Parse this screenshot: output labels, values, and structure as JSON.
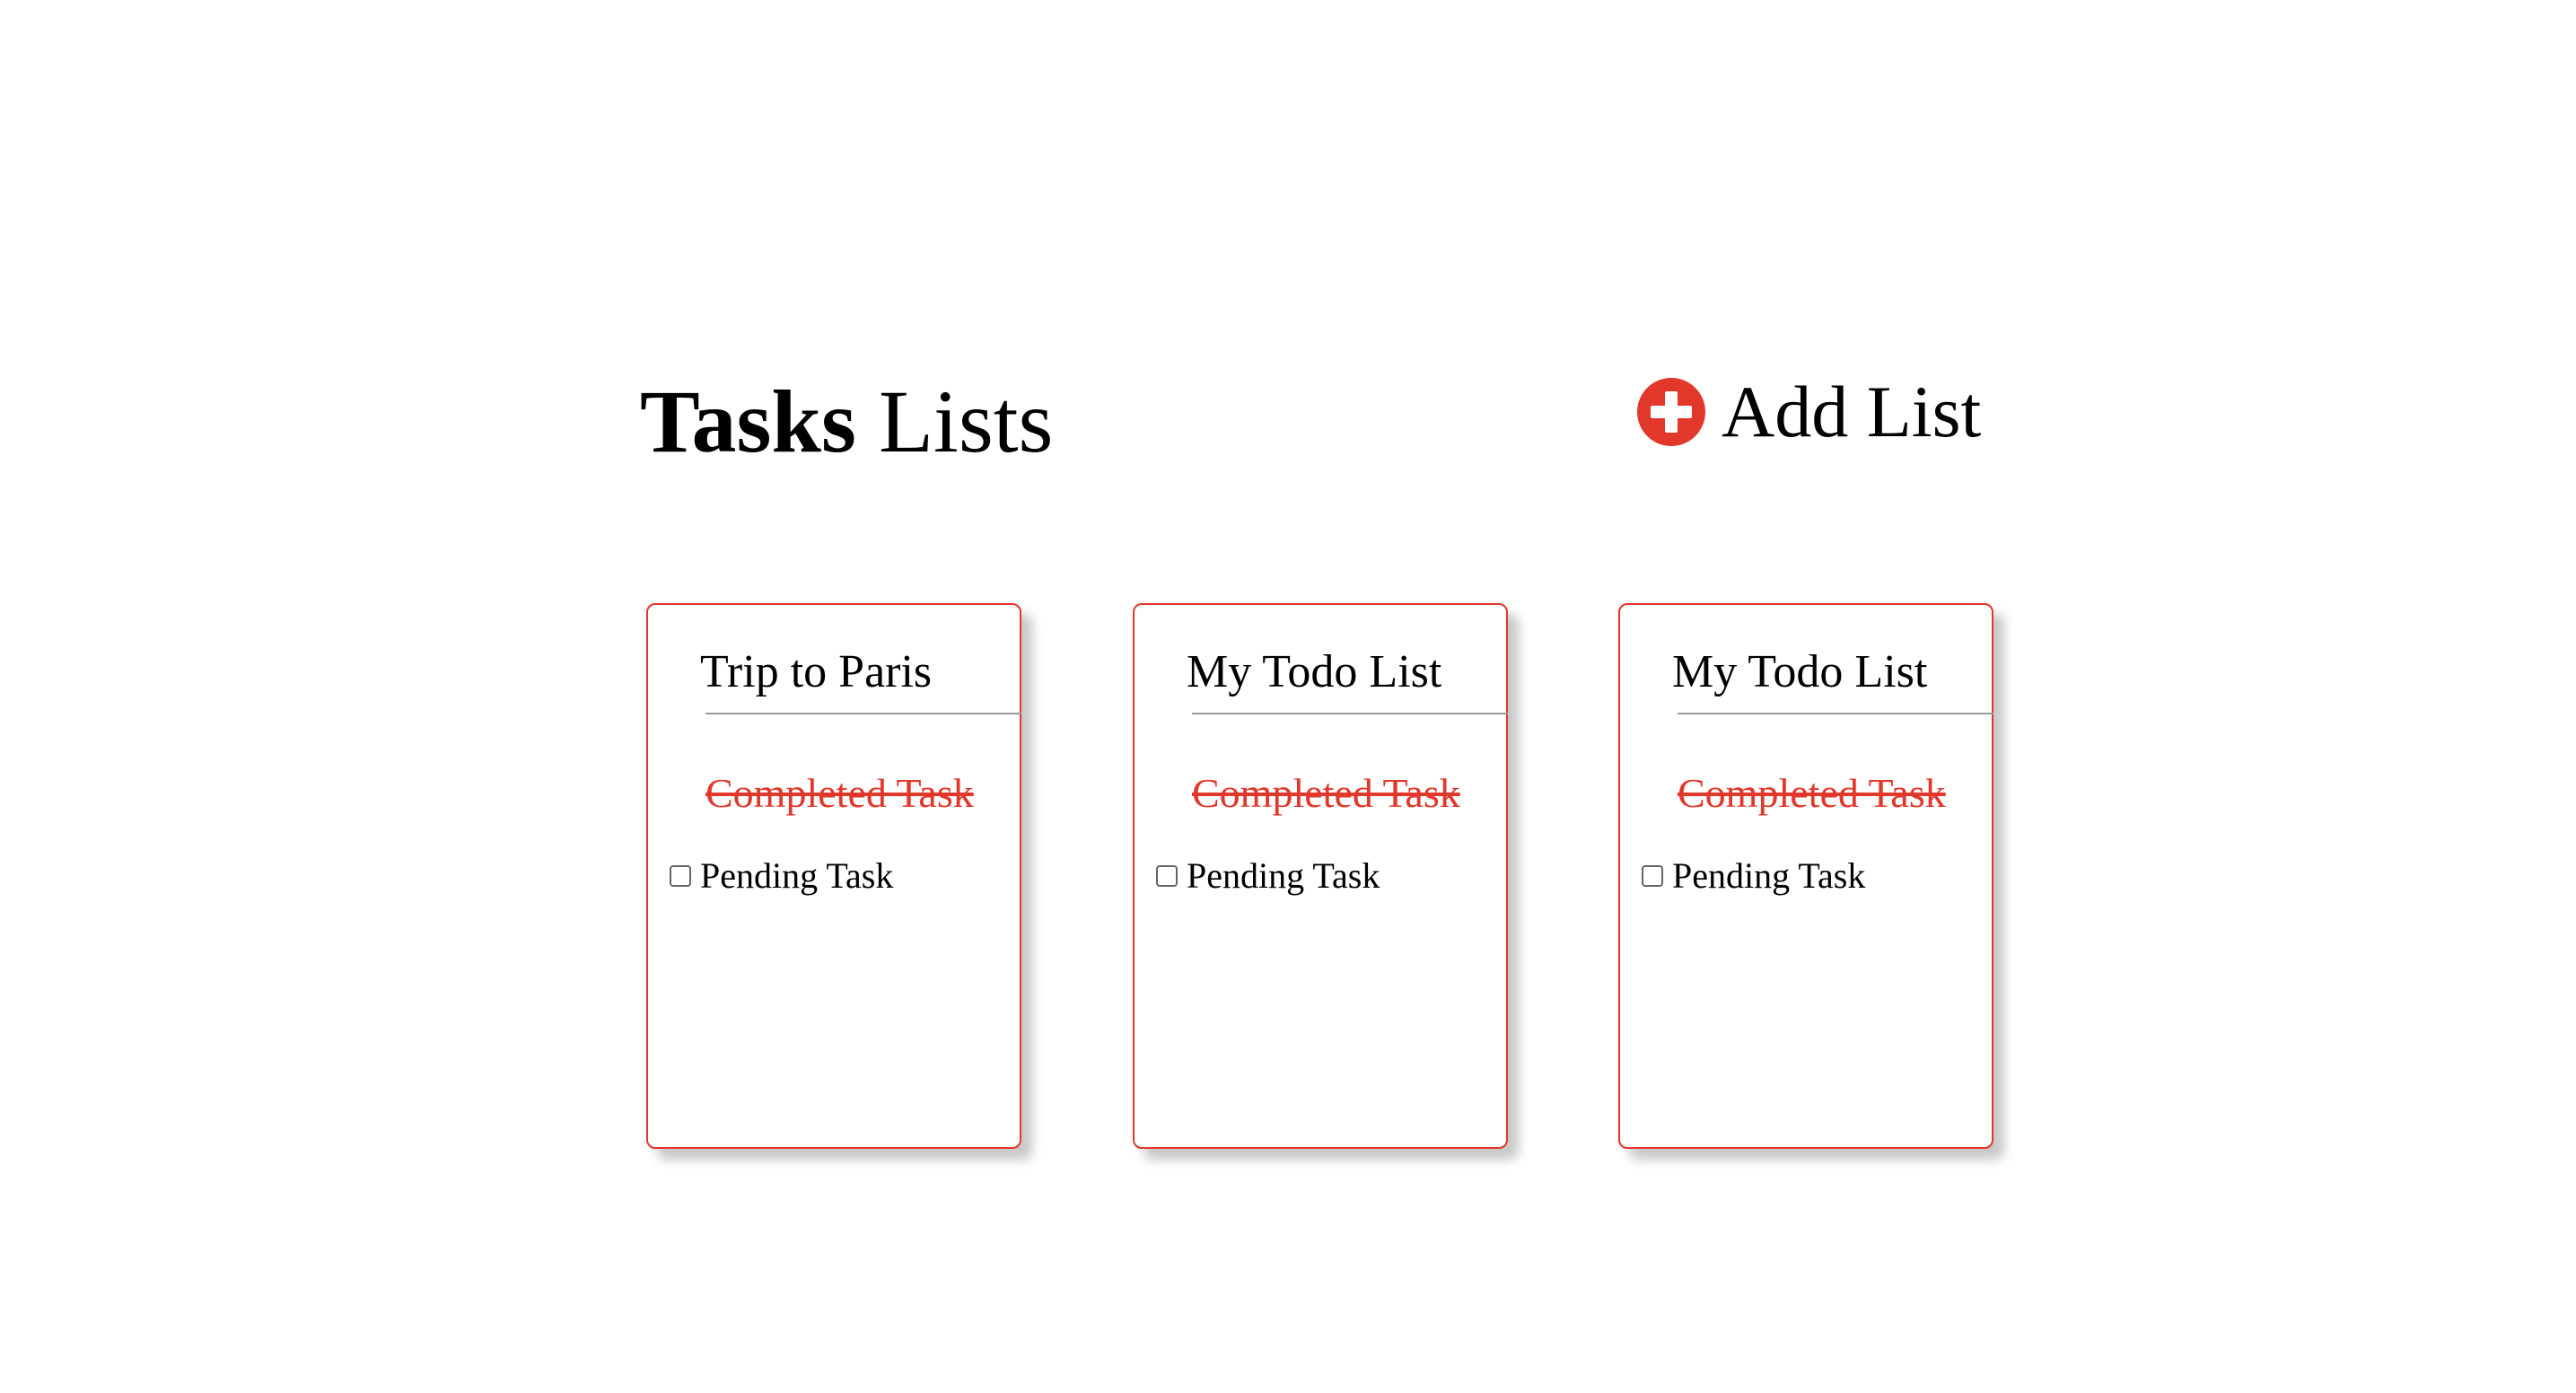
{
  "header": {
    "title_bold": "Tasks",
    "title_rest": " Lists",
    "add_list_label": "Add List",
    "add_icon": "plus-circle-icon"
  },
  "colors": {
    "accent": "#e2372b",
    "text": "#000000",
    "divider": "#9a9a9a"
  },
  "lists": [
    {
      "title": "Trip to Paris",
      "completed_task": "Completed Task",
      "pending_task": "Pending Task",
      "pending_checked": false
    },
    {
      "title": "My Todo List",
      "completed_task": "Completed Task",
      "pending_task": "Pending Task",
      "pending_checked": false
    },
    {
      "title": "My Todo List",
      "completed_task": "Completed Task",
      "pending_task": "Pending Task",
      "pending_checked": false
    }
  ]
}
